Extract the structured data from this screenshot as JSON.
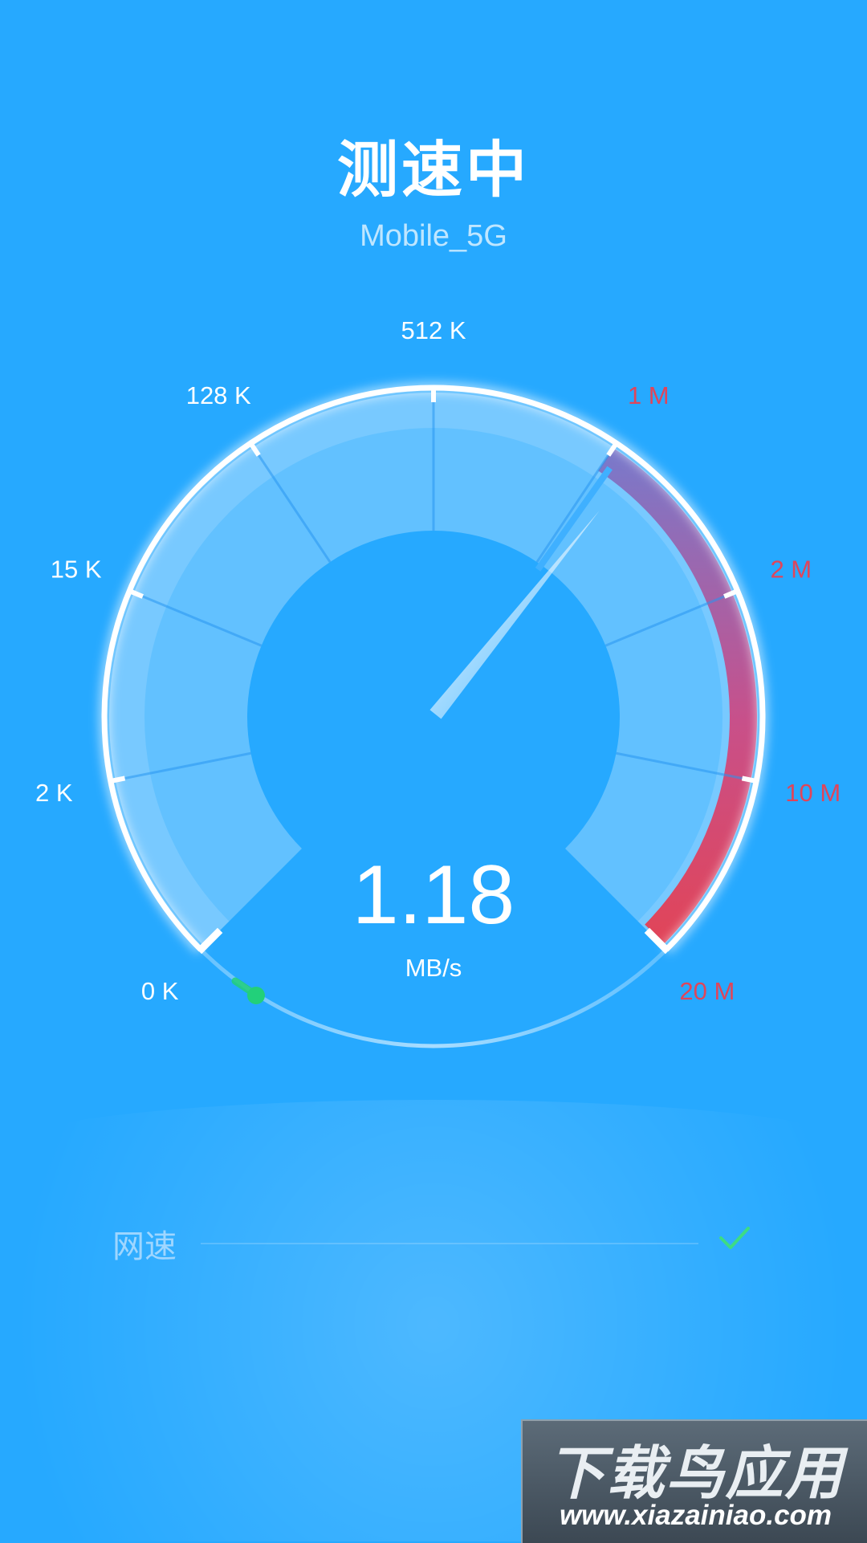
{
  "header": {
    "title": "测速中",
    "network_name": "Mobile_5G"
  },
  "gauge": {
    "scale_labels": [
      {
        "text": "0 K",
        "zone": "normal"
      },
      {
        "text": "2 K",
        "zone": "normal"
      },
      {
        "text": "15 K",
        "zone": "normal"
      },
      {
        "text": "128 K",
        "zone": "normal"
      },
      {
        "text": "512 K",
        "zone": "normal"
      },
      {
        "text": "1 M",
        "zone": "high"
      },
      {
        "text": "2 M",
        "zone": "high"
      },
      {
        "text": "10 M",
        "zone": "high"
      },
      {
        "text": "20 M",
        "zone": "high"
      }
    ],
    "speed_value": "1.18",
    "speed_unit": "MB/s",
    "needle_scale_position": 5.15,
    "colors": {
      "label_normal": "#ffffff",
      "label_high": "#e0455a",
      "high_zone_start": "#7b78c9",
      "high_zone_end": "#e0455a",
      "progress_dot": "#22d07a"
    }
  },
  "results": {
    "rows": [
      {
        "label": "网速",
        "status_icon": "check-icon",
        "status_color": "#3ddc84"
      }
    ]
  },
  "watermark": {
    "brand": "下载鸟应用",
    "url": "www.xiazainiao.com"
  }
}
